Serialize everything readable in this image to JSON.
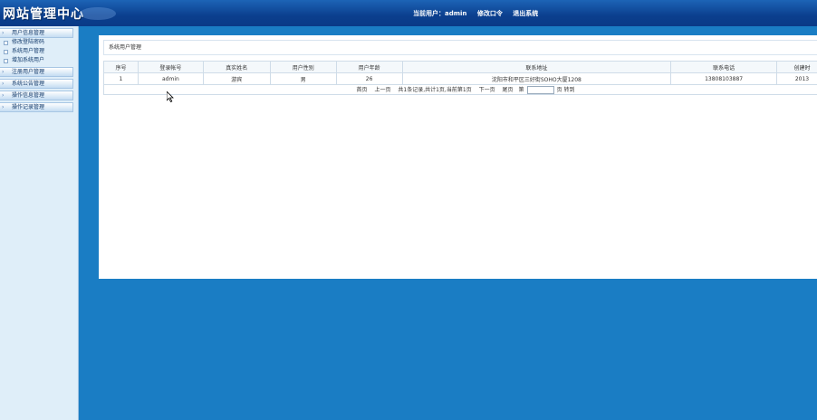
{
  "header": {
    "logo": "网站管理中心",
    "current_user": "当前用户：admin",
    "change_password": "修改口令",
    "logout": "退出系统"
  },
  "sidebar": {
    "groups": [
      {
        "label": "用户信息管理",
        "items": [
          "修改登陆密码",
          "系统用户管理",
          "增加系统用户"
        ]
      },
      {
        "label": "注册用户管理",
        "items": []
      },
      {
        "label": "系统公告管理",
        "items": []
      },
      {
        "label": "操作信息管理",
        "items": []
      },
      {
        "label": "操作记录管理",
        "items": []
      }
    ]
  },
  "main": {
    "title": "系统用户管理",
    "columns": [
      "序号",
      "登录帐号",
      "真实姓名",
      "用户性别",
      "用户年龄",
      "联系地址",
      "联系电话",
      "创建时"
    ],
    "rows": [
      [
        "1",
        "admin",
        "游宾",
        "男",
        "26",
        "沈阳市和平区三好街SOHO大厦1208",
        "13808103887",
        "2013"
      ]
    ],
    "pager": {
      "first": "首页",
      "prev": "上一页",
      "summary": "共1条记录,共计1页,当前第1页",
      "next": "下一页",
      "last": "尾页",
      "goto_prefix": "第",
      "goto_suffix": "页 转到"
    }
  }
}
